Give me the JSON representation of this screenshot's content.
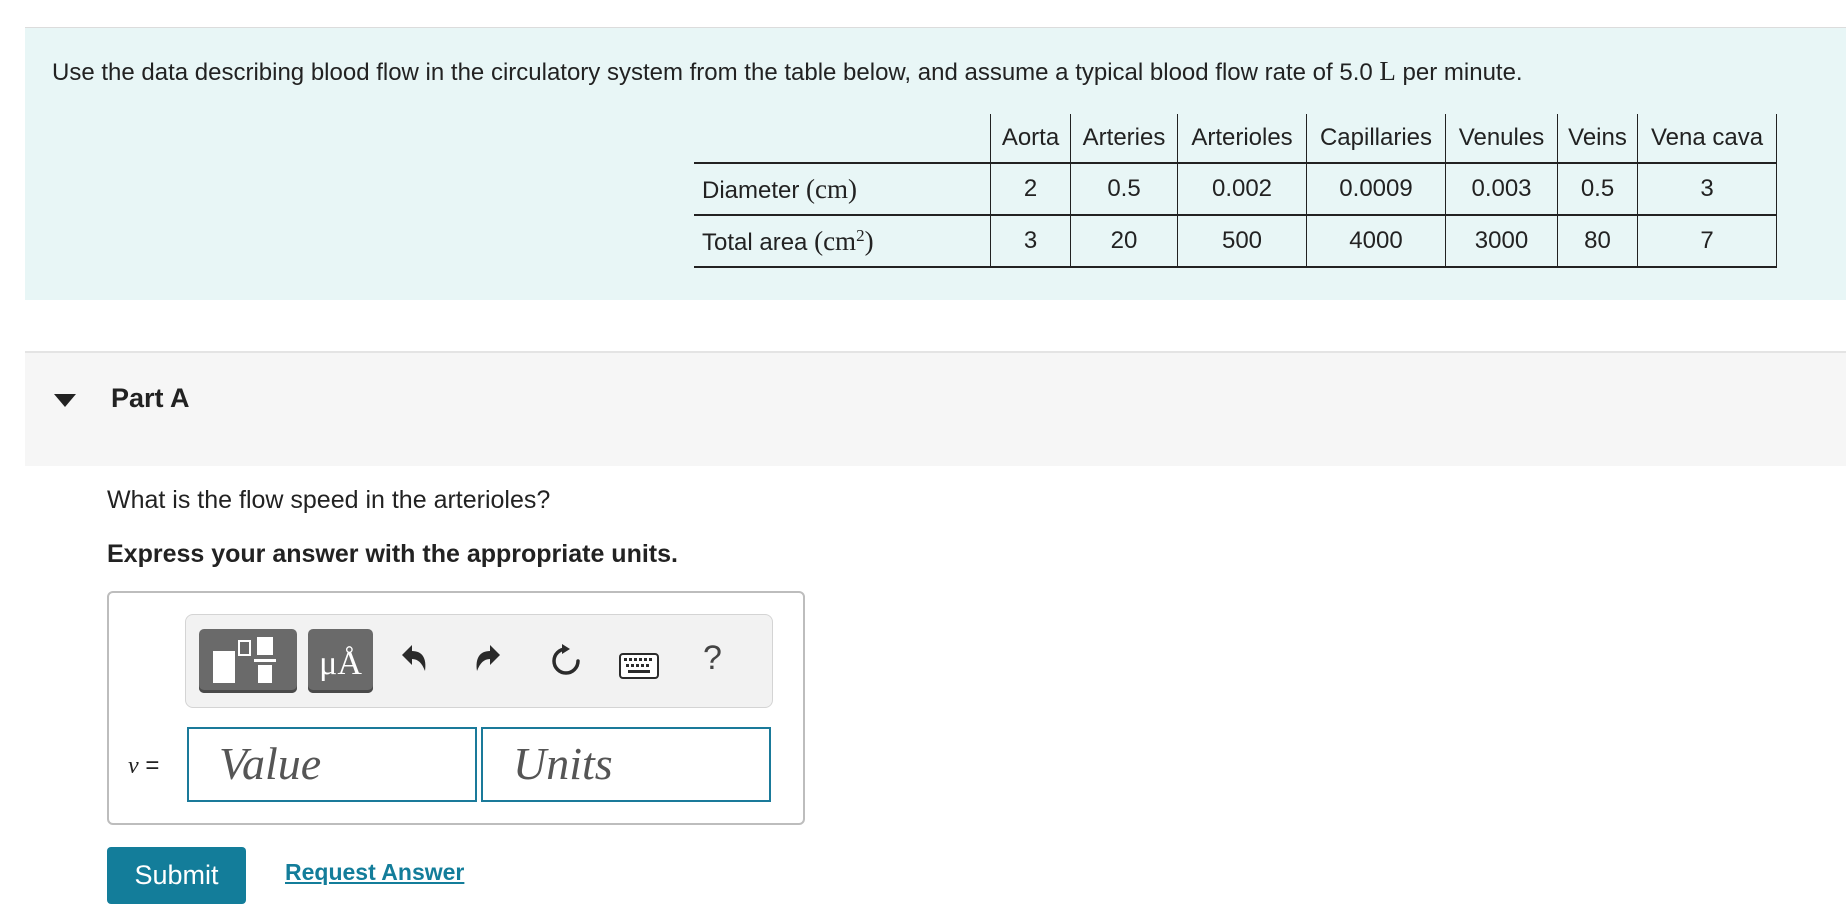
{
  "intro": {
    "text_before": "Use the data describing blood flow in the circulatory system from the table below, and assume a typical blood flow rate of 5.0 ",
    "unit": "L",
    "text_after": " per minute."
  },
  "table": {
    "columns": [
      "Aorta",
      "Arteries",
      "Arterioles",
      "Capillaries",
      "Venules",
      "Veins",
      "Vena cava"
    ],
    "rows": [
      {
        "label": "Diameter ",
        "unit": "(cm)",
        "unit_sup": "",
        "unit_close": "",
        "values": [
          "2",
          "0.5",
          "0.002",
          "0.0009",
          "0.003",
          "0.5",
          "3"
        ]
      },
      {
        "label": "Total area ",
        "unit": "(cm",
        "unit_sup": "2",
        "unit_close": ")",
        "values": [
          "3",
          "20",
          "500",
          "4000",
          "3000",
          "80",
          "7"
        ]
      }
    ]
  },
  "part": {
    "title": "Part A",
    "question": "What is the flow speed in the arterioles?",
    "instruction": "Express your answer with the appropriate units."
  },
  "toolbar": {
    "units_button_label": "μÅ",
    "help_label": "?",
    "icons": [
      "templates-icon",
      "units-icon",
      "undo-icon",
      "redo-icon",
      "reset-icon",
      "keyboard-icon",
      "help-icon"
    ]
  },
  "answer": {
    "variable": "v",
    "equals": " =",
    "value_placeholder": "Value",
    "units_placeholder": "Units"
  },
  "actions": {
    "submit_label": "Submit",
    "request_label": "Request Answer"
  },
  "colors": {
    "intro_bg": "#e8f6f6",
    "accent": "#137d9a",
    "part_header_bg": "#f6f6f6"
  }
}
